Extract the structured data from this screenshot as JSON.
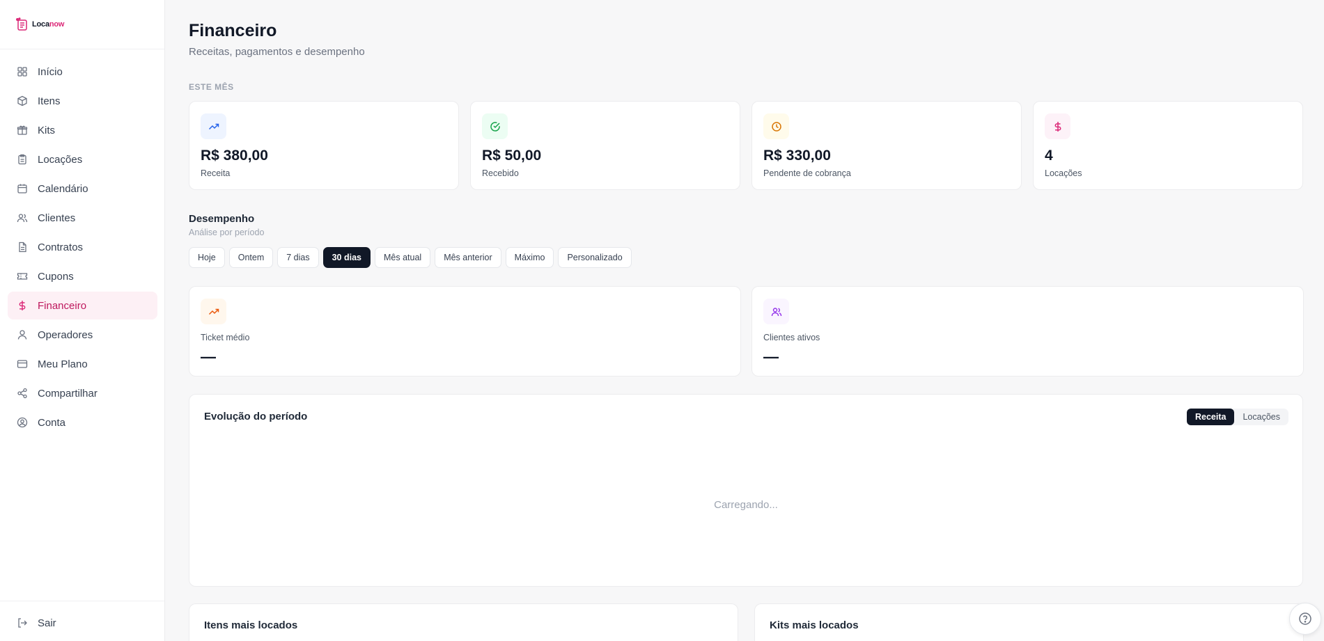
{
  "brand": {
    "name_part1": "Loca",
    "name_part2": "now",
    "color": "#db2777"
  },
  "sidebar": {
    "items": [
      {
        "label": "Início",
        "icon": "grid-icon",
        "active": false
      },
      {
        "label": "Itens",
        "icon": "box-icon",
        "active": false
      },
      {
        "label": "Kits",
        "icon": "gift-icon",
        "active": false
      },
      {
        "label": "Locações",
        "icon": "clipboard-icon",
        "active": false
      },
      {
        "label": "Calendário",
        "icon": "calendar-icon",
        "active": false
      },
      {
        "label": "Clientes",
        "icon": "users-icon",
        "active": false
      },
      {
        "label": "Contratos",
        "icon": "file-icon",
        "active": false
      },
      {
        "label": "Cupons",
        "icon": "ticket-icon",
        "active": false
      },
      {
        "label": "Financeiro",
        "icon": "dollar-icon",
        "active": true
      },
      {
        "label": "Operadores",
        "icon": "user-icon",
        "active": false
      },
      {
        "label": "Meu Plano",
        "icon": "credit-card-icon",
        "active": false
      },
      {
        "label": "Compartilhar",
        "icon": "share-icon",
        "active": false
      },
      {
        "label": "Conta",
        "icon": "user-circle-icon",
        "active": false
      }
    ],
    "logout_label": "Sair"
  },
  "header": {
    "title": "Financeiro",
    "subtitle": "Receitas, pagamentos e desempenho"
  },
  "this_month": {
    "section_label": "ESTE MÊS",
    "cards": [
      {
        "value": "R$ 380,00",
        "label": "Receita",
        "icon": "trending-up-icon",
        "icon_bg": "#eef4ff",
        "icon_color": "#2563eb"
      },
      {
        "value": "R$ 50,00",
        "label": "Recebido",
        "icon": "check-circle-icon",
        "icon_bg": "#ecfdf3",
        "icon_color": "#16a34a"
      },
      {
        "value": "R$ 330,00",
        "label": "Pendente de cobrança",
        "icon": "clock-icon",
        "icon_bg": "#fffbeb",
        "icon_color": "#d97706"
      },
      {
        "value": "4",
        "label": "Locações",
        "icon": "dollar-icon",
        "icon_bg": "#fdf2f8",
        "icon_color": "#db2777"
      }
    ]
  },
  "performance": {
    "title": "Desempenho",
    "subtitle": "Análise por período",
    "filters": [
      "Hoje",
      "Ontem",
      "7 dias",
      "30 dias",
      "Mês atual",
      "Mês anterior",
      "Máximo",
      "Personalizado"
    ],
    "active_filter": "30 dias",
    "metrics": [
      {
        "label": "Ticket médio",
        "value": "—",
        "icon": "trending-up-icon",
        "icon_bg": "#fff7ed",
        "icon_color": "#ea580c"
      },
      {
        "label": "Clientes ativos",
        "value": "—",
        "icon": "users-icon",
        "icon_bg": "#faf5ff",
        "icon_color": "#9333ea"
      }
    ]
  },
  "evolution": {
    "title": "Evolução do período",
    "toggle": [
      "Receita",
      "Locações"
    ],
    "active_toggle": "Receita",
    "loading_text": "Carregando..."
  },
  "bottom": {
    "items_title": "Itens mais locados",
    "kits_title": "Kits mais locados"
  }
}
